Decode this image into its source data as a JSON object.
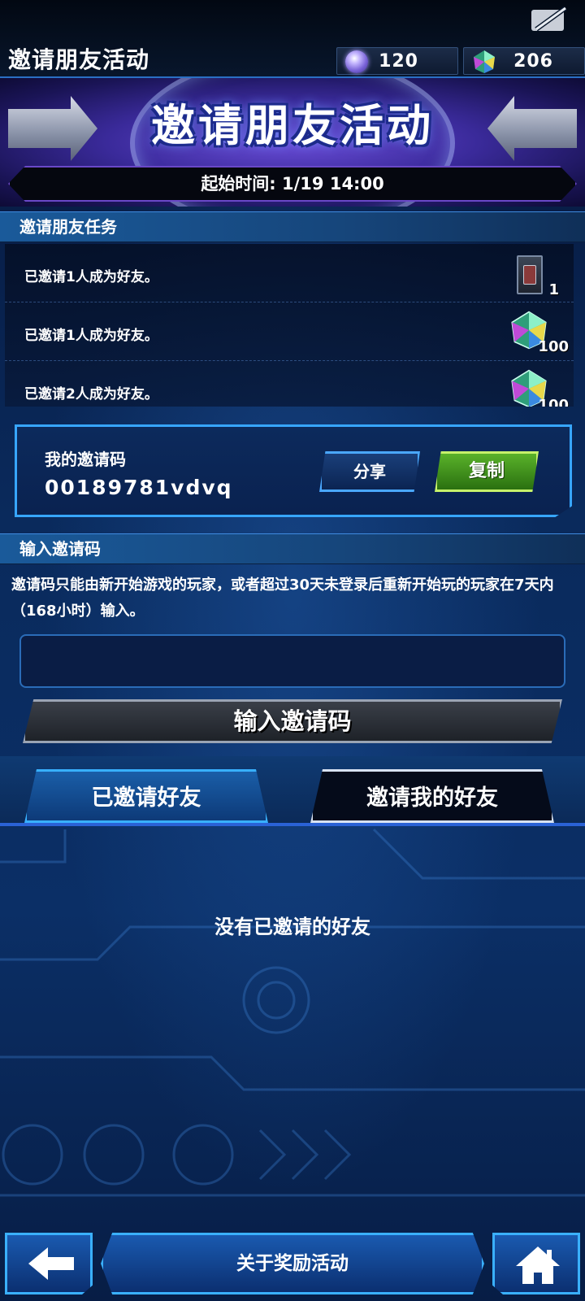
{
  "header": {
    "title": "邀请朋友活动",
    "currencies": [
      {
        "icon": "orb-icon",
        "value": "120"
      },
      {
        "icon": "gem-icon",
        "value": "206"
      }
    ]
  },
  "banner": {
    "title": "邀请朋友活动",
    "start_time": "起始时间: 1/19 14:00"
  },
  "missions": {
    "header": "邀请朋友任务",
    "items": [
      {
        "text": "已邀请1人成为好友。",
        "reward_icon": "card-pack-icon",
        "reward_qty": "1"
      },
      {
        "text": "已邀请1人成为好友。",
        "reward_icon": "gem-icon",
        "reward_qty": "100"
      },
      {
        "text": "已邀请2人成为好友。",
        "reward_icon": "gem-icon",
        "reward_qty": "100"
      }
    ]
  },
  "my_code": {
    "label": "我的邀请码",
    "value": "00189781vdvq",
    "share_label": "分享",
    "copy_label": "复制"
  },
  "enter_code": {
    "header": "输入邀请码",
    "description": "邀请码只能由新开始游戏的玩家，或者超过30天未登录后重新开始玩的玩家在7天内（168小时）输入。",
    "input_value": "",
    "button_label": "输入邀请码"
  },
  "tabs": [
    {
      "label": "已邀请好友",
      "active": true
    },
    {
      "label": "邀请我的好友",
      "active": false
    }
  ],
  "empty_message": "没有已邀请的好友",
  "footer": {
    "back_icon": "back-arrow-icon",
    "about_label": "关于奖励活动",
    "home_icon": "home-icon"
  }
}
